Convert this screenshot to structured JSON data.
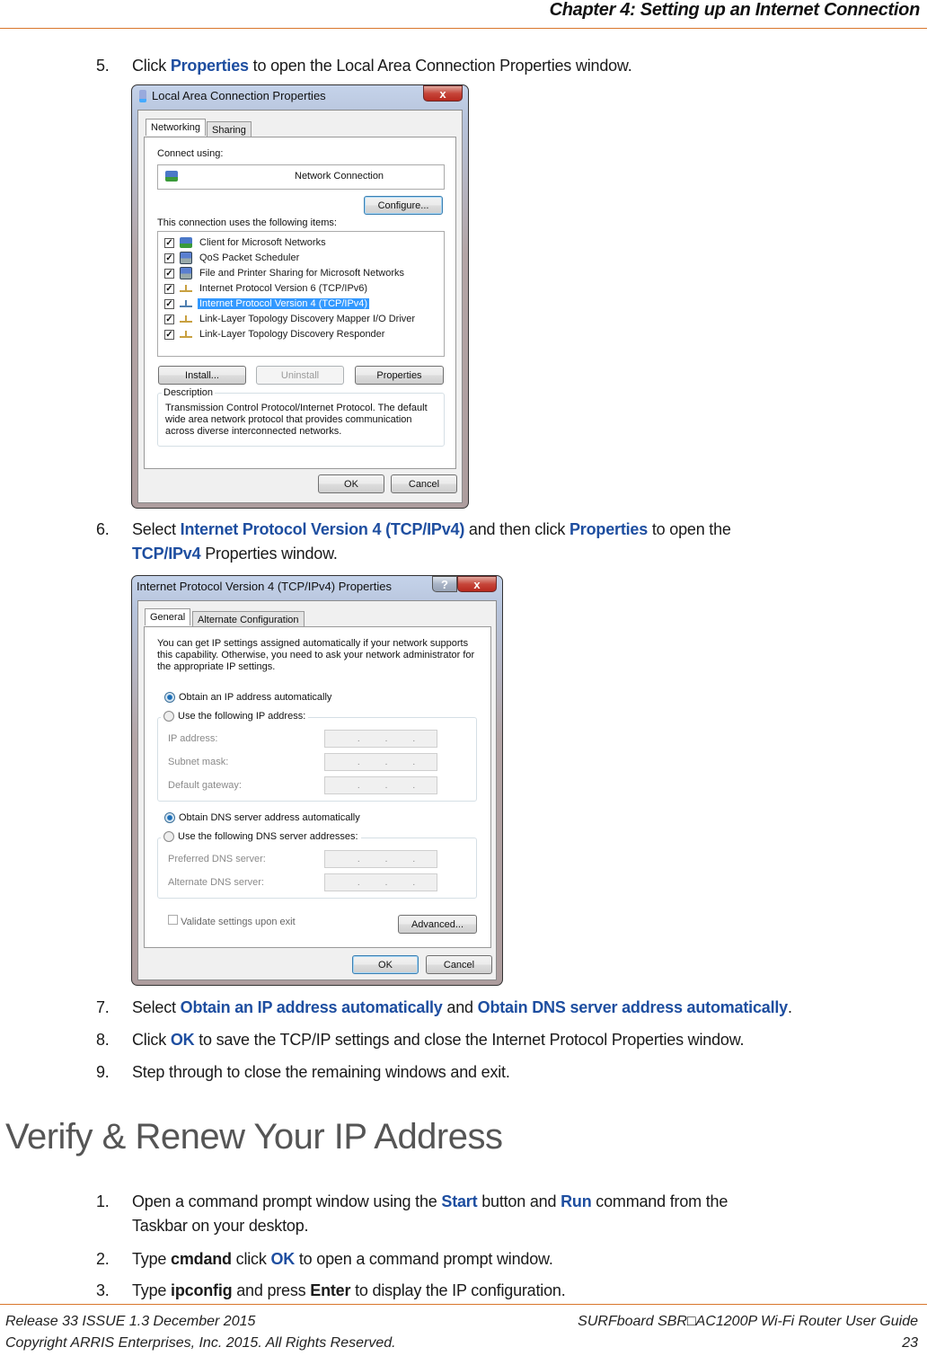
{
  "header": {
    "chapter": "Chapter 4: Setting up an Internet Connection"
  },
  "steps_part1": [
    {
      "num": "5.",
      "parts": [
        {
          "t": "Click "
        },
        {
          "t": "Properties",
          "hl": true
        },
        {
          "t": " to open the Local Area Connection Properties window."
        }
      ]
    },
    {
      "num": "6.",
      "parts": [
        {
          "t": "Select "
        },
        {
          "t": "Internet Protocol Version 4 (TCP/IPv4)",
          "hl": true
        },
        {
          "t": " and then click "
        },
        {
          "t": "Properties",
          "hl": true
        },
        {
          "t": " to open the"
        }
      ],
      "cont": [
        {
          "t": "TCP/IPv4",
          "hl": true
        },
        {
          "t": " Properties window."
        }
      ]
    },
    {
      "num": "7.",
      "parts": [
        {
          "t": "Select "
        },
        {
          "t": "Obtain an IP address automatically",
          "hl": true
        },
        {
          "t": " and "
        },
        {
          "t": "Obtain DNS server address automatically",
          "hl": true
        },
        {
          "t": "."
        }
      ]
    },
    {
      "num": "8.",
      "parts": [
        {
          "t": "Click "
        },
        {
          "t": "OK",
          "hl": true
        },
        {
          "t": " to save the TCP/IP settings and close the Internet Protocol Properties window."
        }
      ]
    },
    {
      "num": "9.",
      "parts": [
        {
          "t": "Step through to close the remaining windows and exit."
        }
      ]
    }
  ],
  "section_title": "Verify & Renew Your IP Address",
  "steps_part2": [
    {
      "num": "1.",
      "parts": [
        {
          "t": "Open a command prompt window using the "
        },
        {
          "t": "Start",
          "hl": true
        },
        {
          "t": " button and "
        },
        {
          "t": "Run",
          "hl": true
        },
        {
          "t": " command from the"
        }
      ],
      "cont": [
        {
          "t": "Taskbar on your desktop."
        }
      ]
    },
    {
      "num": "2.",
      "parts": [
        {
          "t": "Type "
        },
        {
          "t": "cmdand",
          "bold": true
        },
        {
          "t": " click "
        },
        {
          "t": "OK",
          "hl": true
        },
        {
          "t": " to open a command prompt window."
        }
      ]
    },
    {
      "num": "3.",
      "parts": [
        {
          "t": "Type "
        },
        {
          "t": "ipconfig",
          "bold": true
        },
        {
          "t": " and press "
        },
        {
          "t": "Enter",
          "bold": true
        },
        {
          "t": " to display the IP configuration."
        }
      ]
    }
  ],
  "lan_dialog": {
    "title": "Local Area Connection Properties",
    "close_glyph": "x",
    "tabs": [
      "Networking",
      "Sharing"
    ],
    "connect_using_label": "Connect using:",
    "adapter_name": "Network Connection",
    "configure_button": "Configure...",
    "items_label": "This connection uses the following items:",
    "items": [
      {
        "label": "Client for Microsoft Networks",
        "checked": true,
        "icon": "network-client-icon"
      },
      {
        "label": "QoS Packet Scheduler",
        "checked": true,
        "icon": "service-icon"
      },
      {
        "label": "File and Printer Sharing for Microsoft Networks",
        "checked": true,
        "icon": "service-icon"
      },
      {
        "label": "Internet Protocol Version 6 (TCP/IPv6)",
        "checked": true,
        "icon": "protocol-icon"
      },
      {
        "label": "Internet Protocol Version 4 (TCP/IPv4)",
        "checked": true,
        "icon": "protocol-icon",
        "selected": true
      },
      {
        "label": "Link-Layer Topology Discovery Mapper I/O Driver",
        "checked": true,
        "icon": "protocol-icon"
      },
      {
        "label": "Link-Layer Topology Discovery Responder",
        "checked": true,
        "icon": "protocol-icon"
      }
    ],
    "install_button": "Install...",
    "uninstall_button": "Uninstall",
    "properties_button": "Properties",
    "description_label": "Description",
    "description_text": "Transmission Control Protocol/Internet Protocol. The default wide area network protocol that provides communication across diverse interconnected networks.",
    "ok_button": "OK",
    "cancel_button": "Cancel"
  },
  "ipv4_dialog": {
    "title": "Internet Protocol Version 4 (TCP/IPv4) Properties",
    "help_glyph": "?",
    "close_glyph": "x",
    "tabs": [
      "General",
      "Alternate Configuration"
    ],
    "intro_text": "You can get IP settings assigned automatically if your network supports this capability. Otherwise, you need to ask your network administrator for the appropriate IP settings.",
    "obtain_ip_auto": "Obtain an IP address automatically",
    "use_following_ip": "Use the following IP address:",
    "ip_address_label": "IP address:",
    "subnet_mask_label": "Subnet mask:",
    "default_gateway_label": "Default gateway:",
    "ip_placeholder": ".   .   .",
    "obtain_dns_auto": "Obtain DNS server address automatically",
    "use_following_dns": "Use the following DNS server addresses:",
    "preferred_dns_label": "Preferred DNS server:",
    "alternate_dns_label": "Alternate DNS server:",
    "validate_label": "Validate settings upon exit",
    "validate_checked": false,
    "advanced_button": "Advanced...",
    "ok_button": "OK",
    "cancel_button": "Cancel"
  },
  "footer": {
    "release": "Release 33 ISSUE 1.3    December 2015",
    "guide": "SURFboard SBR□AC1200P Wi-Fi Router User Guide",
    "copyright": "Copyright ARRIS Enterprises, Inc. 2015. All Rights Reserved.",
    "page_number": "23"
  },
  "colors": {
    "accent_text": "#1e4ea0",
    "rule": "#d9762b",
    "selection": "#3399ff"
  }
}
